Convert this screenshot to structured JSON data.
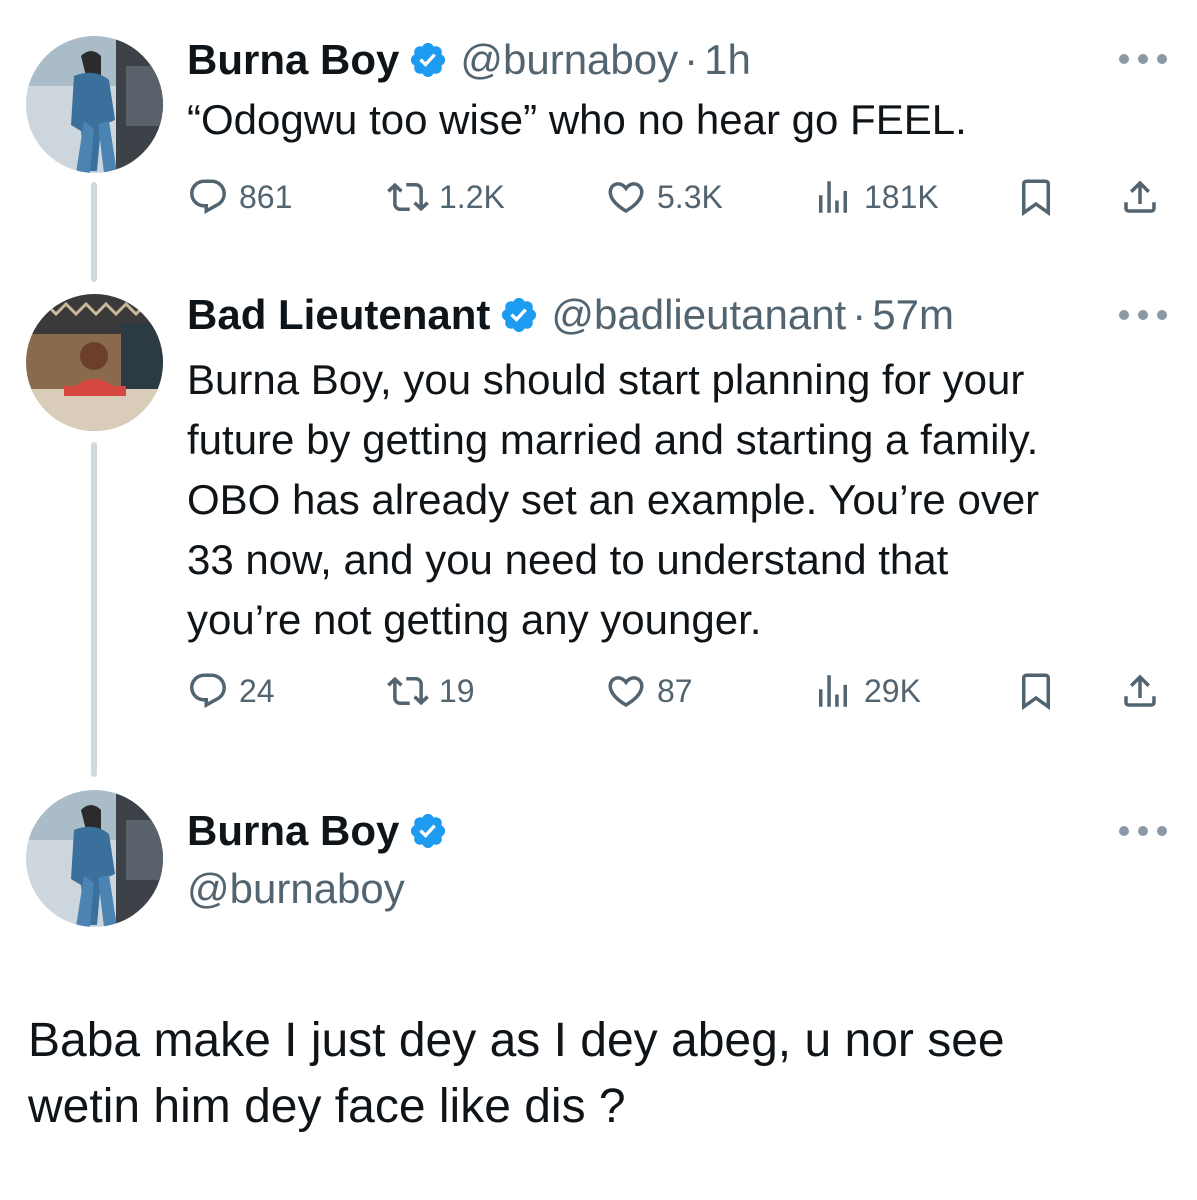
{
  "tweets": [
    {
      "name": "Burna Boy",
      "handle": "@burnaboy",
      "separator": "·",
      "time": "1h",
      "text": "“Odogwu too wise”  who no hear go FEEL.",
      "stats": {
        "replies": "861",
        "retweets": "1.2K",
        "likes": "5.3K",
        "views": "181K"
      }
    },
    {
      "name": "Bad Lieutenant",
      "handle": "@badlieutanant",
      "separator": "·",
      "time": "57m",
      "text_lines": [
        "Burna Boy, you should start planning for your",
        "future by getting married and starting a family.",
        "OBO has already set an example. You’re over",
        "33 now, and you need to understand that",
        "you’re not getting any younger."
      ],
      "stats": {
        "replies": "24",
        "retweets": "19",
        "likes": "87",
        "views": "29K"
      }
    }
  ],
  "focused": {
    "name": "Burna Boy",
    "handle": "@burnaboy",
    "text_lines": [
      "Baba make I just dey as I dey abeg, u nor see",
      "wetin him dey face like dis ?"
    ]
  },
  "icons": {
    "reply": "reply-icon",
    "retweet": "retweet-icon",
    "like": "like-icon",
    "views": "views-icon",
    "bookmark": "bookmark-icon",
    "share": "share-icon",
    "verified": "verified-badge-icon",
    "more": "more-options-icon"
  },
  "colors": {
    "text": "#0f1419",
    "secondary": "#536471",
    "verified": "#1d9bf0",
    "thread_line": "#cfd9de"
  }
}
